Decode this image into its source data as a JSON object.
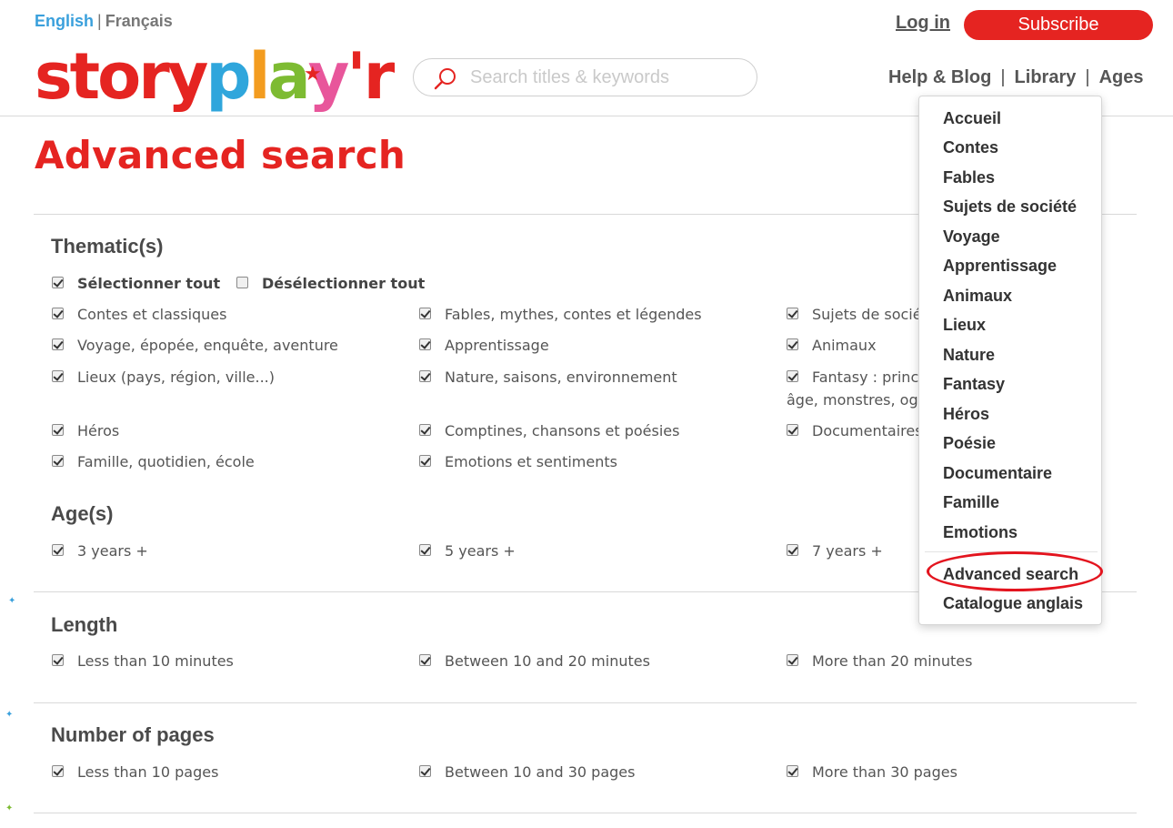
{
  "header": {
    "lang_en": "English",
    "lang_sep": "|",
    "lang_fr": "Français",
    "logo": {
      "parts": [
        "story",
        "p",
        "l",
        "a",
        "y",
        "'r"
      ],
      "star": "★"
    },
    "search_placeholder": "Search titles & keywords",
    "login": "Log in",
    "subscribe": "Subscribe",
    "nav": {
      "help_blog": "Help & Blog",
      "library": "Library",
      "ages": "Ages",
      "divider": "|"
    }
  },
  "page": {
    "title": "Advanced search"
  },
  "thematics": {
    "title": "Thematic(s)",
    "select_all": "Sélectionner tout",
    "deselect_all": "Désélectionner tout",
    "items": [
      "Contes et classiques",
      "Fables, mythes, contes et légendes",
      "Sujets de socié",
      "Voyage, épopée, enquête, aventure",
      "Apprentissage",
      "Animaux",
      "Lieux (pays, région, ville...)",
      "Nature, saisons, environnement",
      "Fantasy : prince",
      "âge, monstres, ogr",
      "Héros",
      "Comptines, chansons et poésies",
      "Documentaires",
      "Famille, quotidien, école",
      "Emotions et sentiments"
    ]
  },
  "ages": {
    "title": "Age(s)",
    "items": [
      "3 years +",
      "5 years +",
      "7 years +"
    ]
  },
  "length": {
    "title": "Length",
    "items": [
      "Less than 10 minutes",
      "Between 10 and 20 minutes",
      "More than 20 minutes"
    ]
  },
  "pages": {
    "title": "Number of pages",
    "items": [
      "Less than 10 pages",
      "Between 10 and 30 pages",
      "More than 30 pages"
    ]
  },
  "dropdown": {
    "items": [
      "Accueil",
      "Contes",
      "Fables",
      "Sujets de société",
      "Voyage",
      "Apprentissage",
      "Animaux",
      "Lieux",
      "Nature",
      "Fantasy",
      "Héros",
      "Poésie",
      "Documentaire",
      "Famille",
      "Emotions"
    ],
    "advanced": "Advanced search",
    "catalogue": "Catalogue anglais"
  },
  "colors": {
    "brand_red": "#e52421",
    "logo_p": "#2fa6dc",
    "logo_l": "#f39c1f",
    "logo_a": "#7dbb32",
    "logo_y": "#e8569b",
    "link_blue": "#3aa0dc"
  }
}
